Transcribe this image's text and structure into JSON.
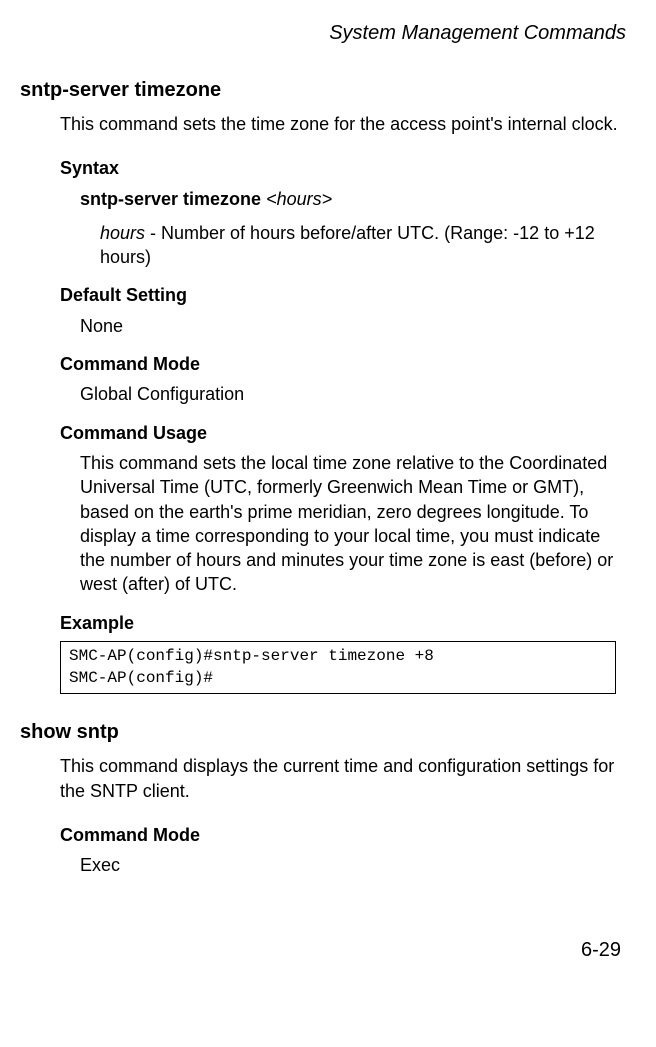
{
  "chapter_title": "System Management Commands",
  "cmd1": {
    "heading": "sntp-server timezone",
    "intro": "This command sets the time zone for the access point's internal clock.",
    "syntax_label": "Syntax",
    "syntax_bold": "sntp-server timezone",
    "syntax_arg": "<hours>",
    "param_name": "hours",
    "param_desc_rest": " - Number of hours before/after UTC. (Range: -12 to +12 hours)",
    "default_label": "Default Setting",
    "default_value": "None",
    "mode_label": "Command Mode",
    "mode_value": "Global Configuration",
    "usage_label": "Command Usage",
    "usage_text": "This command sets the local time zone relative to the Coordinated Universal Time (UTC, formerly Greenwich Mean Time or GMT), based on the earth's prime meridian, zero degrees longitude. To display a time corresponding to your local time, you must indicate the number of hours and minutes your time zone is east (before) or west (after) of UTC.",
    "example_label": "Example",
    "example_code": "SMC-AP(config)#sntp-server timezone +8\nSMC-AP(config)#"
  },
  "cmd2": {
    "heading": "show sntp",
    "intro": "This command displays the current time and configuration settings for the SNTP client.",
    "mode_label": "Command Mode",
    "mode_value": "Exec"
  },
  "page_number": "6-29"
}
